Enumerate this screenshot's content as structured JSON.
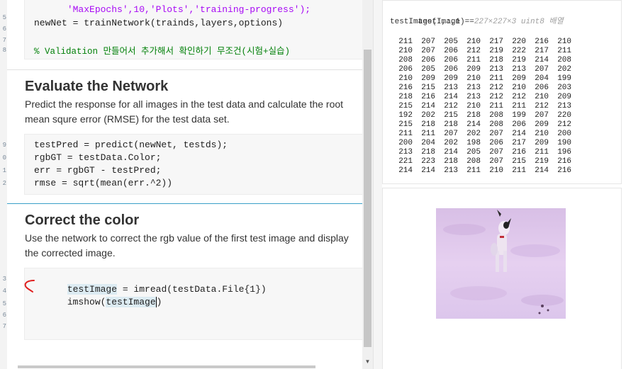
{
  "editor": {
    "top_partial_line": "'MaxEpochs',10,'Plots','training-progress');",
    "train_line": "newNet = trainNetwork(trainds,layers,options)",
    "comment_line": "% Validation 만들어서 추가해서 확인하기 무조건(시험+실습)",
    "section1": {
      "title": "Evaluate the Network",
      "desc": "Predict the response for all images in the test data and calculate the root mean squre error (RMSE) for the test data set.",
      "code": [
        "testPred = predict(newNet, testds);",
        "rgbGT = testData.Color;",
        "err = rgbGT - testPred;",
        "rmse = sqrt(mean(err.^2))"
      ]
    },
    "section2": {
      "title": "Correct the color",
      "desc": "Use the network to correct the rgb value of the first test image and display the corrected image.",
      "code_line1_var": "testImage",
      "code_line1_rest": " = imread(testData.File{1})",
      "code_line2_fn": "imshow(",
      "code_line2_var": "testImage",
      "code_line2_close": ")"
    },
    "line_numbers": [
      "5",
      "6",
      "7",
      "8",
      "9",
      "0",
      "1",
      "2",
      "3",
      "4",
      "5",
      "6",
      "7"
    ]
  },
  "output": {
    "var_line_name": "testImage = ",
    "var_line_info": "227×227×3 uint8 배열",
    "slice_line": "testImage(:,:,1) =",
    "matrix": [
      [
        "211",
        "207",
        "205",
        "210",
        "217",
        "220",
        "216",
        "210"
      ],
      [
        "210",
        "207",
        "206",
        "212",
        "219",
        "222",
        "217",
        "211"
      ],
      [
        "208",
        "206",
        "206",
        "211",
        "218",
        "219",
        "214",
        "208"
      ],
      [
        "206",
        "205",
        "206",
        "209",
        "213",
        "213",
        "207",
        "202"
      ],
      [
        "210",
        "209",
        "209",
        "210",
        "211",
        "209",
        "204",
        "199"
      ],
      [
        "216",
        "215",
        "213",
        "213",
        "212",
        "210",
        "206",
        "203"
      ],
      [
        "218",
        "216",
        "214",
        "213",
        "212",
        "212",
        "210",
        "209"
      ],
      [
        "215",
        "214",
        "212",
        "210",
        "211",
        "211",
        "212",
        "213"
      ],
      [
        "192",
        "202",
        "215",
        "218",
        "208",
        "199",
        "207",
        "220"
      ],
      [
        "215",
        "218",
        "218",
        "214",
        "208",
        "206",
        "209",
        "212"
      ],
      [
        "211",
        "211",
        "207",
        "202",
        "207",
        "214",
        "210",
        "200"
      ],
      [
        "200",
        "204",
        "202",
        "198",
        "206",
        "217",
        "209",
        "190"
      ],
      [
        "213",
        "218",
        "214",
        "205",
        "207",
        "216",
        "211",
        "196"
      ],
      [
        "221",
        "223",
        "218",
        "208",
        "207",
        "215",
        "219",
        "216"
      ],
      [
        "214",
        "214",
        "213",
        "211",
        "210",
        "211",
        "214",
        "216"
      ]
    ]
  },
  "colors": {
    "comment": "#028009",
    "string": "#a709f5",
    "section_accent": "#3aa0c8",
    "annotation": "#e02020"
  }
}
